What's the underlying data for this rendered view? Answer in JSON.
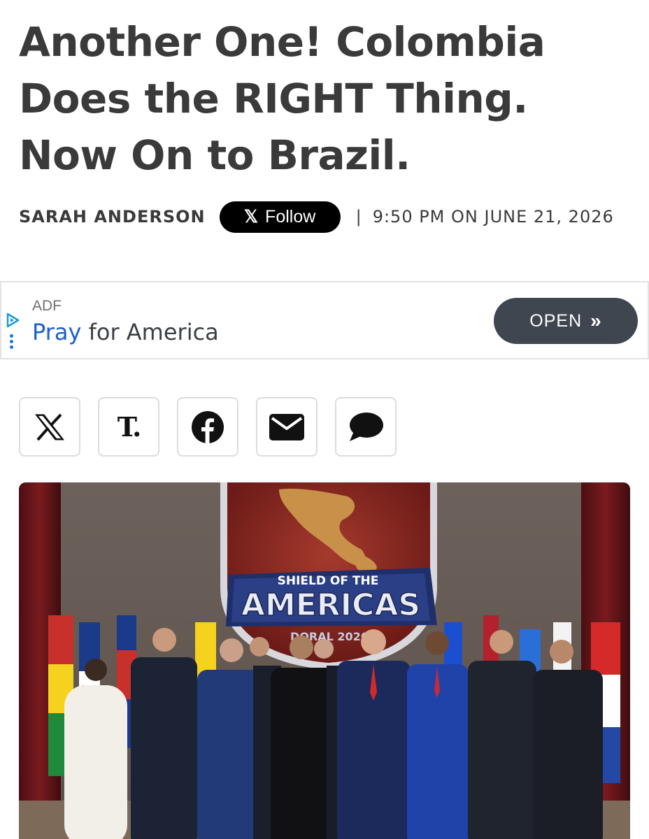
{
  "article": {
    "headline": "Another One! Colombia Does the RIGHT Thing. Now On to Brazil.",
    "author": "SARAH ANDERSON",
    "follow_icon": "x-logo-icon",
    "follow_label": "Follow",
    "separator": "|",
    "timestamp": "9:50 PM ON JUNE 21, 2026"
  },
  "ad": {
    "source": "ADF",
    "text_highlight": "Pray",
    "text_rest": " for America",
    "cta_label": "OPEN",
    "cta_icon": "double-chevron-right-icon",
    "highlight_color": "#1a5fd1"
  },
  "share": {
    "buttons": [
      {
        "icon": "x-logo-icon"
      },
      {
        "icon": "truth-social-icon",
        "glyph": "T."
      },
      {
        "icon": "facebook-icon"
      },
      {
        "icon": "email-icon"
      },
      {
        "icon": "comment-icon"
      }
    ]
  },
  "photo": {
    "emblem_line1": "SHIELD OF THE",
    "emblem_line2": "AMERICAS",
    "emblem_line3": "DORAL 2026"
  }
}
